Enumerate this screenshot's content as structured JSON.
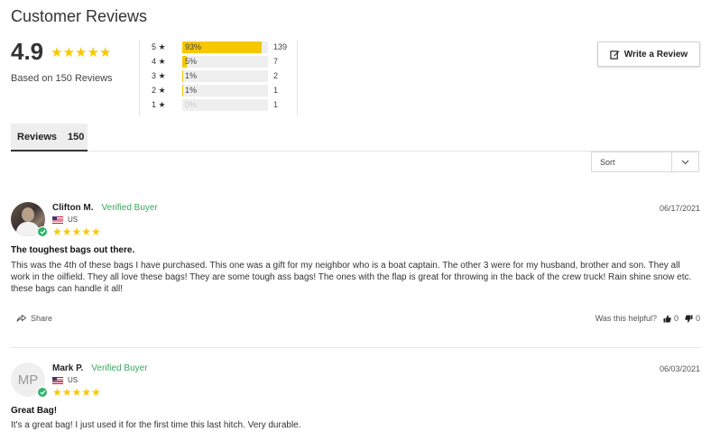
{
  "page": {
    "title": "Customer Reviews"
  },
  "summary": {
    "average": "4.9",
    "stars": "★★★★★",
    "based_on": "Based on 150 Reviews"
  },
  "histogram": [
    {
      "label": "5 ★",
      "percent_text": "93%",
      "percent": 93,
      "count": "139"
    },
    {
      "label": "4 ★",
      "percent_text": "5%",
      "percent": 5,
      "count": "7"
    },
    {
      "label": "3 ★",
      "percent_text": "1%",
      "percent": 1,
      "count": "2"
    },
    {
      "label": "2 ★",
      "percent_text": "1%",
      "percent": 1,
      "count": "1"
    },
    {
      "label": "1 ★",
      "percent_text": "0%",
      "percent": 0,
      "count": "1"
    }
  ],
  "write_button": {
    "label": "Write a Review",
    "icon": "edit-icon"
  },
  "tabs": [
    {
      "label": "Reviews",
      "count": "150"
    }
  ],
  "sort": {
    "label": "Sort",
    "icon": "chevron-down-icon"
  },
  "reviews": [
    {
      "name": "Clifton M.",
      "verified": "Verified Buyer",
      "country": "US",
      "stars": "★★★★★",
      "date": "06/17/2021",
      "title": "The toughest bags out there.",
      "body": "This was the 4th of these bags I have purchased. This one was a gift for my neighbor who is a boat captain. The other 3 were for my husband, brother and son. They all work in the oilfield. They all love these bags! They are some tough ass bags! The ones with the flap is great for throwing in the back of the crew truck! Rain shine snow etc. these bags can handle it all!",
      "share": "Share",
      "helpful_label": "Was this helpful?",
      "upvotes": "0",
      "downvotes": "0"
    },
    {
      "name": "Mark P.",
      "initials": "MP",
      "verified": "Verified Buyer",
      "country": "US",
      "stars": "★★★★★",
      "date": "06/03/2021",
      "title": "Great Bag!",
      "body": "It's a great bag! I just used it for the first time this last hitch. Very durable."
    }
  ],
  "colors": {
    "star": "#f7c800",
    "verified": "#3aa85e",
    "check_badge": "#2fb36b"
  }
}
